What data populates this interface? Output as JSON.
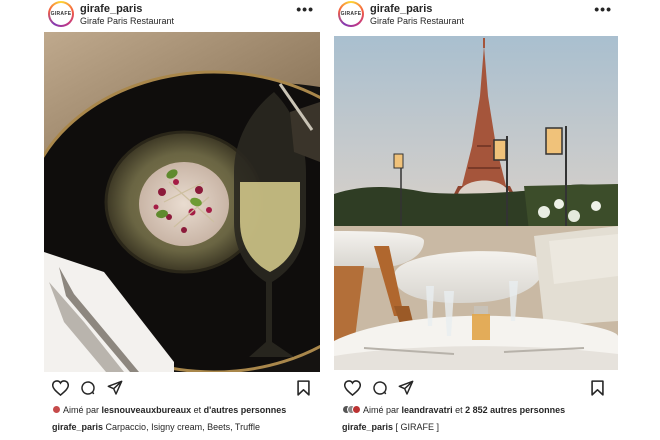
{
  "posts": [
    {
      "username": "girafe_paris",
      "avatar_text": "GIRAFE",
      "location": "Girafe Paris Restaurant",
      "more": "•••",
      "liked_by_prefix": "Aimé par",
      "liked_by_user": "lesnouveauxbureaux",
      "liked_by_middle": "et",
      "liked_by_rest": "d'autres personnes",
      "caption_user": "girafe_paris",
      "caption_text": "Carpaccio, Isigny cream, Beets, Truffle"
    },
    {
      "username": "girafe_paris",
      "avatar_text": "GIRAFE",
      "location": "Girafe Paris Restaurant",
      "more": "•••",
      "liked_by_prefix": "Aimé par",
      "liked_by_user": "leandravatri",
      "liked_by_middle": "et",
      "liked_by_rest": "2 852 autres personnes",
      "caption_user": "girafe_paris",
      "caption_text": "[ GIRAFE ]"
    }
  ],
  "icons": [
    "heart-icon",
    "comment-icon",
    "share-icon",
    "bookmark-icon"
  ]
}
